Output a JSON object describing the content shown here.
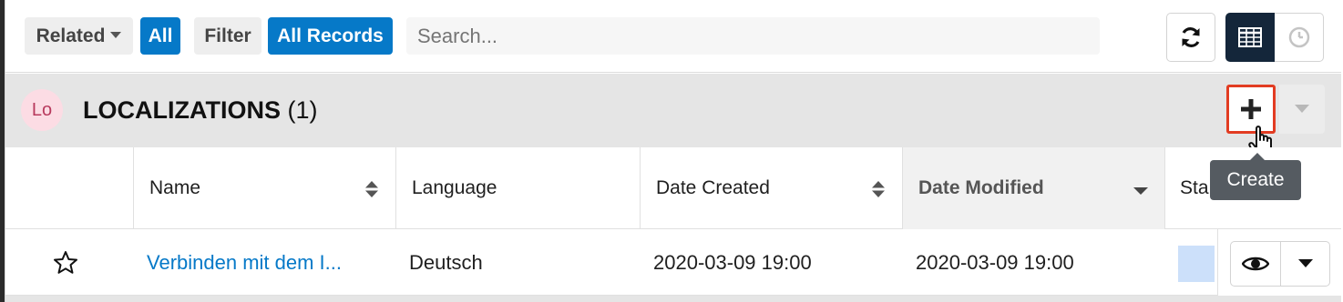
{
  "toolbar": {
    "related_label": "Related",
    "related_value": "All",
    "filter_label": "Filter",
    "filter_value": "All Records",
    "search_placeholder": "Search..."
  },
  "header": {
    "avatar": "Lo",
    "title": "LOCALIZATIONS",
    "count": "(1)"
  },
  "tooltip": "Create",
  "table": {
    "columns": [
      "Name",
      "Language",
      "Date Created",
      "Date Modified",
      "Sta"
    ],
    "rows": [
      {
        "name": "Verbinden mit dem I...",
        "language": "Deutsch",
        "date_created": "2020-03-09 19:00",
        "date_modified": "2020-03-09 19:00"
      }
    ]
  },
  "icons": {
    "refresh": "refresh-icon",
    "list_view": "table-view-icon",
    "activity_view": "clock-icon",
    "create": "plus-icon",
    "dropdown": "caret-down-icon",
    "favorite": "star-outline-icon",
    "preview": "eye-icon",
    "cursor": "hand-pointer-icon"
  },
  "colors": {
    "accent": "#0679c8",
    "highlight_border": "#e23c22",
    "dark_button": "#14263a",
    "avatar_bg": "#fcdce4"
  }
}
